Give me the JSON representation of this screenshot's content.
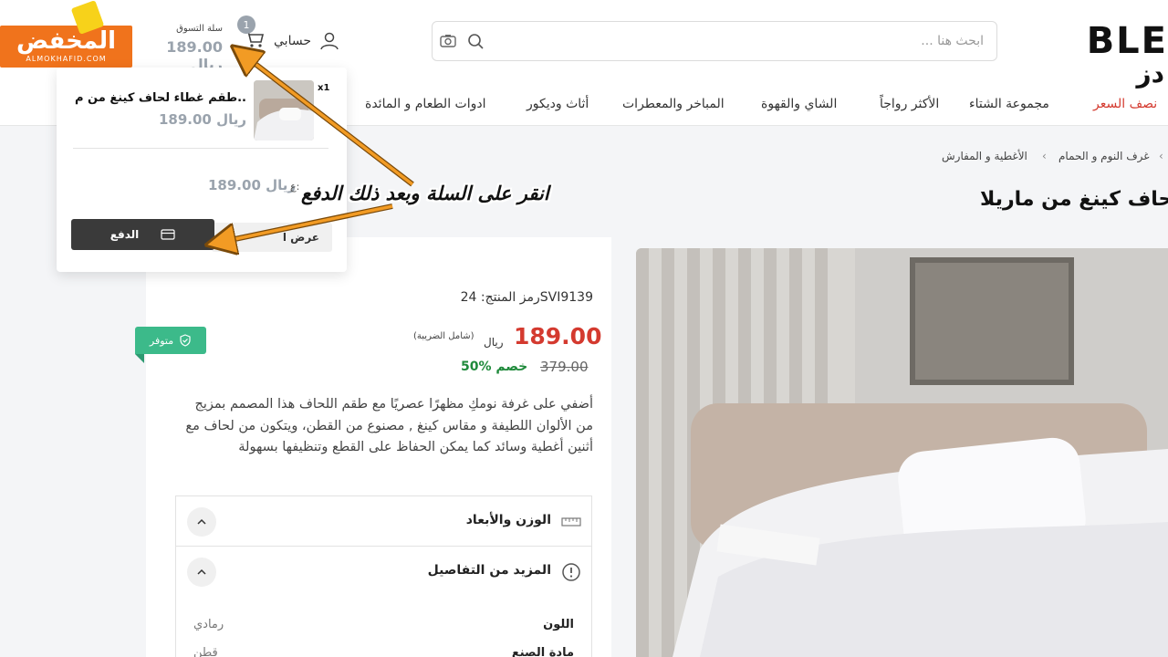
{
  "header": {
    "brand_top": "BLE",
    "brand_sub": "دز",
    "search_placeholder": "ابحث هنا ...",
    "account_label": "حسابي",
    "cart_count": "1",
    "cart_title": "سلة التسوق",
    "cart_total": "189.00 ريال"
  },
  "watermark": {
    "arabic": "المخفض",
    "latin": "ALMOKHAFID.COM"
  },
  "nav": {
    "items": [
      "نصف السعر",
      "مجموعة الشتاء",
      "الأكثر رواجاً",
      "الشاي والقهوة",
      "المباخر والمعطرات",
      "أثاث وديكور",
      "ادوات الطعام و المائدة"
    ]
  },
  "cart_dropdown": {
    "qty": "x1",
    "item_name": "طقم غطاء لحاف كينغ من م...",
    "item_price": "189.00 ريال",
    "total_label": "ع:",
    "total": "189.00 ريال",
    "view_cart": "عرض ا",
    "checkout": "الدفع"
  },
  "breadcrumb": [
    "غرف النوم و الحمام",
    "الأغطية و المفارش"
  ],
  "product": {
    "title": "لحاف كينغ من ماريلا",
    "stock": "متوفر",
    "sku": "رمز المنتج: 24SVI9139",
    "price": "189.00",
    "currency": "ريال",
    "tax_note": "(شامل الضريبة)",
    "old_price": "379.00",
    "discount": "50% خصم",
    "description": "أضفي على غرفة نومكِ مظهرًا عصريًا مع طقم اللحاف هذا المصمم بمزيج من الألوان اللطيفة و مقاس كينغ , مصنوع من القطن، ويتكون من لحاف مع أثنين أغطية وسائد كما يمكن الحفاظ على القطع وتنظيفها بسهولة"
  },
  "accordions": {
    "weight": "الوزن والأبعاد",
    "details": "المزيد من التفاصيل"
  },
  "specs": [
    {
      "key": "اللون",
      "value": "رمادي"
    },
    {
      "key": "مادة الصنع",
      "value": "قطن"
    }
  ],
  "annotation": "انقر على السلة وبعد ذلك الدفع",
  "colors": {
    "accent_red": "#d43a2f",
    "orange": "#f0731c",
    "stock_green": "#3cba8a",
    "discount_green": "#1f8a3b"
  }
}
